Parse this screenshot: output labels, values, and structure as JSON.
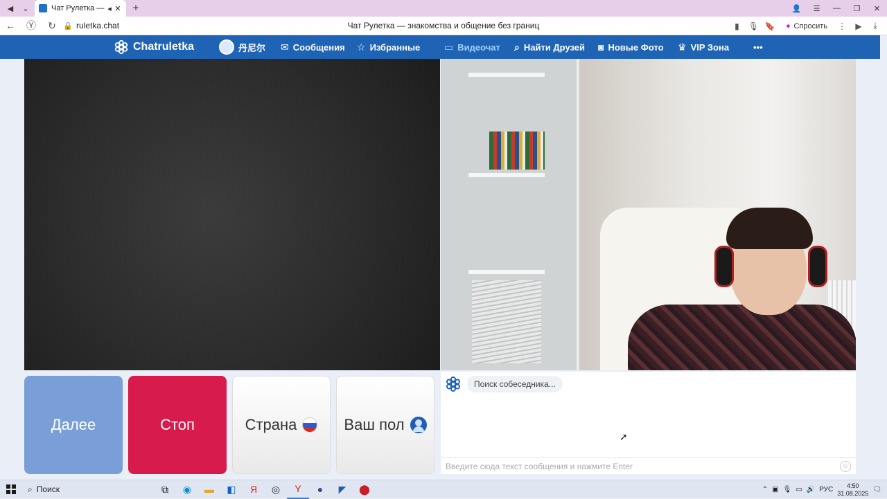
{
  "browser": {
    "tab_title": "Чат Рулетка — знак",
    "url": "ruletka.chat",
    "page_title": "Чат Рулетка — знакомства и общение без границ",
    "ask_label": "Спросить"
  },
  "site": {
    "logo_text": "Chatruletka",
    "user_name": "丹尼尔",
    "nav": {
      "messages": "Сообщения",
      "favorites": "Избранные",
      "videochat": "Видеочат",
      "find_friends": "Найти Друзей",
      "new_photos": "Новые Фото",
      "vip": "VIP Зона",
      "more": "•••"
    }
  },
  "controls": {
    "next": "Далее",
    "stop": "Стоп",
    "country": "Страна",
    "gender": "Ваш пол"
  },
  "chat": {
    "status_message": "Поиск собеседника...",
    "input_placeholder": "Введите сюда текст сообщения и нажмите Enter"
  },
  "taskbar": {
    "search_label": "Поиск",
    "lang": "РУС",
    "time": "4:50",
    "date": "31.08.2025"
  },
  "colors": {
    "nav_bg": "#1f63b5",
    "next_btn": "#7a9fd8",
    "stop_btn": "#d81b4d"
  }
}
